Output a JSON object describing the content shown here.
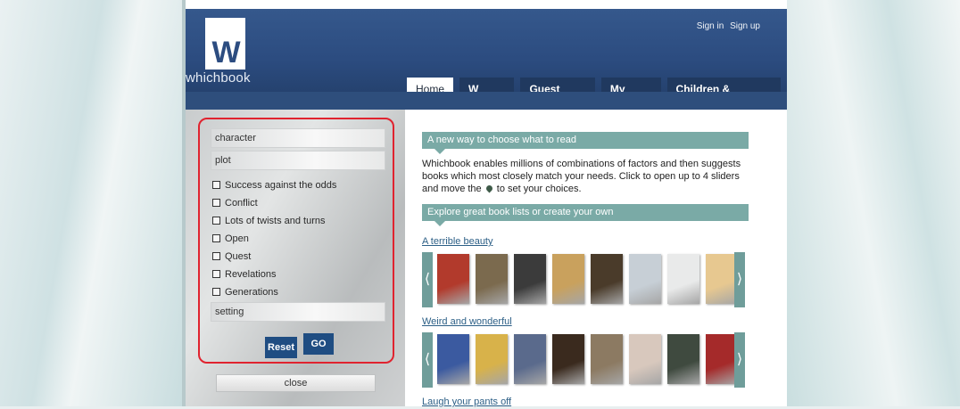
{
  "header": {
    "logo_letter": "W",
    "logo_text": "whichbook",
    "sign_in": "Sign in",
    "sign_up": "Sign up"
  },
  "nav": {
    "tabs": [
      {
        "label": "Home",
        "active": true
      },
      {
        "label": "W Lists",
        "active": false
      },
      {
        "label": "Guest Lists",
        "active": false
      },
      {
        "label": "My Lists",
        "active": false
      },
      {
        "label": "Children & Schools",
        "active": false
      }
    ]
  },
  "sidebar": {
    "categories": {
      "character": "character",
      "plot": "plot",
      "setting": "setting"
    },
    "plot_options": [
      "Success against the odds",
      "Conflict",
      "Lots of twists and turns",
      "Open",
      "Quest",
      "Revelations",
      "Generations"
    ],
    "reset_label": "Reset",
    "go_label": "GO",
    "close_label": "close"
  },
  "main": {
    "section1_title": "A new way to choose what to read",
    "intro_part1": "Whichbook enables millions of combinations of factors and then suggests books which most closely match your needs. Click to open up to 4 sliders and move the",
    "intro_part2": "to set your choices.",
    "section2_title": "Explore great book lists or create your own",
    "lists": [
      {
        "title": "A terrible beauty"
      },
      {
        "title": "Weird and wonderful"
      },
      {
        "title": "Laugh your pants off"
      }
    ],
    "cover_colors_row1": [
      "#b23a2c",
      "#7b6a4e",
      "#3b3b3b",
      "#c9a15d",
      "#4a3b2a",
      "#c7cfd6",
      "#e9eaea",
      "#e7c890"
    ],
    "cover_colors_row2": [
      "#3b5aa0",
      "#d8b24a",
      "#5a6a8c",
      "#3a2a1e",
      "#8c7a62",
      "#d8c8bd",
      "#3f4a3f",
      "#a52a2a"
    ]
  },
  "colors": {
    "header_blue": "#2c4c80",
    "teal": "#7aaaa6",
    "button_blue": "#1f4d82",
    "highlight_red": "#e0232f"
  }
}
